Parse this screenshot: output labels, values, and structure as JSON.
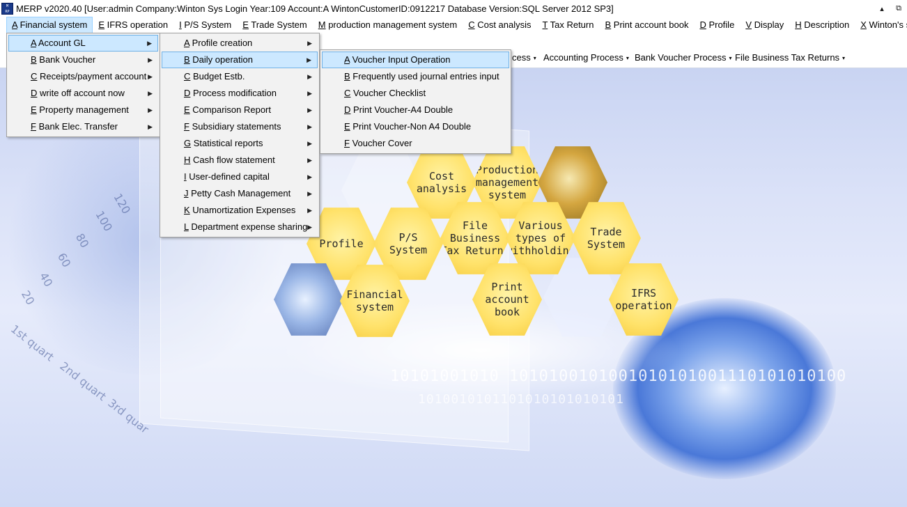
{
  "window": {
    "title": "MERP v2020.40 [User:admin Company:Winton Sys Login Year:109 Account:A WintonCustomerID:0912217 Database Version:SQL Server 2012 SP3]",
    "icon": "app-logo-icon",
    "restore_glyph": "⧉",
    "min_glyph": "▴"
  },
  "menubar": [
    {
      "key": "A",
      "label": " Financial system"
    },
    {
      "key": "E",
      "label": " IFRS operation"
    },
    {
      "key": "I",
      "label": " P/S System"
    },
    {
      "key": "E",
      "label": " Trade System"
    },
    {
      "key": "M",
      "label": " production management system"
    },
    {
      "key": "C",
      "label": " Cost analysis"
    },
    {
      "key": "T",
      "label": " Tax Return"
    },
    {
      "key": "B",
      "label": " Print account book"
    },
    {
      "key": "D",
      "label": " Profile"
    },
    {
      "key": "V",
      "label": " Display"
    },
    {
      "key": "H",
      "label": " Description"
    },
    {
      "key": "X",
      "label": " Winton's service"
    }
  ],
  "toolbar": {
    "items": [
      "cess",
      "Accounting Process",
      "Bank Voucher Process",
      "File Business Tax Returns"
    ],
    "caret": "▾"
  },
  "menu_level1": [
    {
      "key": "A",
      "label": " Account GL"
    },
    {
      "key": "B",
      "label": " Bank Voucher"
    },
    {
      "key": "C",
      "label": " Receipts/payment account"
    },
    {
      "key": "D",
      "label": " write off account now"
    },
    {
      "key": "E",
      "label": " Property management"
    },
    {
      "key": "F",
      "label": " Bank Elec. Transfer"
    }
  ],
  "menu_level2": [
    {
      "key": "A",
      "label": " Profile creation"
    },
    {
      "key": "B",
      "label": " Daily operation"
    },
    {
      "key": "C",
      "label": " Budget Estb."
    },
    {
      "key": "D",
      "label": " Process modification"
    },
    {
      "key": "E",
      "label": " Comparison Report"
    },
    {
      "key": "F",
      "label": " Subsidiary statements"
    },
    {
      "key": "G",
      "label": " Statistical reports"
    },
    {
      "key": "H",
      "label": " Cash flow statement"
    },
    {
      "key": "I",
      "label": " User-defined capital"
    },
    {
      "key": "J",
      "label": " Petty Cash Management"
    },
    {
      "key": "K",
      "label": " Unamortization Expenses"
    },
    {
      "key": "L",
      "label": " Department expense sharing"
    }
  ],
  "menu_level3": [
    {
      "key": "A",
      "label": " Voucher Input Operation"
    },
    {
      "key": "B",
      "label": " Frequently used journal entries input"
    },
    {
      "key": "C",
      "label": " Voucher Checklist"
    },
    {
      "key": "D",
      "label": " Print Voucher-A4 Double"
    },
    {
      "key": "E",
      "label": " Print Voucher-Non A4 Double"
    },
    {
      "key": "F",
      "label": " Voucher Cover"
    }
  ],
  "submenu_arrow": "▶",
  "hexes": {
    "cost_analysis": "Cost\nanalysis",
    "production": "Production\nmanagement\nsystem",
    "profile": "Profile",
    "ps_system": "P/S\nSystem",
    "file_business": "File\nBusiness\nTax Returns",
    "various": "Various\ntypes of\nwithholding",
    "trade": "Trade\nSystem",
    "financial": "Financial\nsystem",
    "print_book": "Print\naccount\nbook",
    "ifrs": "IFRS\noperation"
  },
  "background": {
    "axis_numbers": [
      "120",
      "100",
      "80",
      "60",
      "40",
      "20"
    ],
    "quarters": [
      "1st quart",
      "2nd quart",
      "3rd quar"
    ],
    "binary": "10101001010 1010100101001010101001110101010100",
    "binary2": "1010010101101010101010101"
  }
}
